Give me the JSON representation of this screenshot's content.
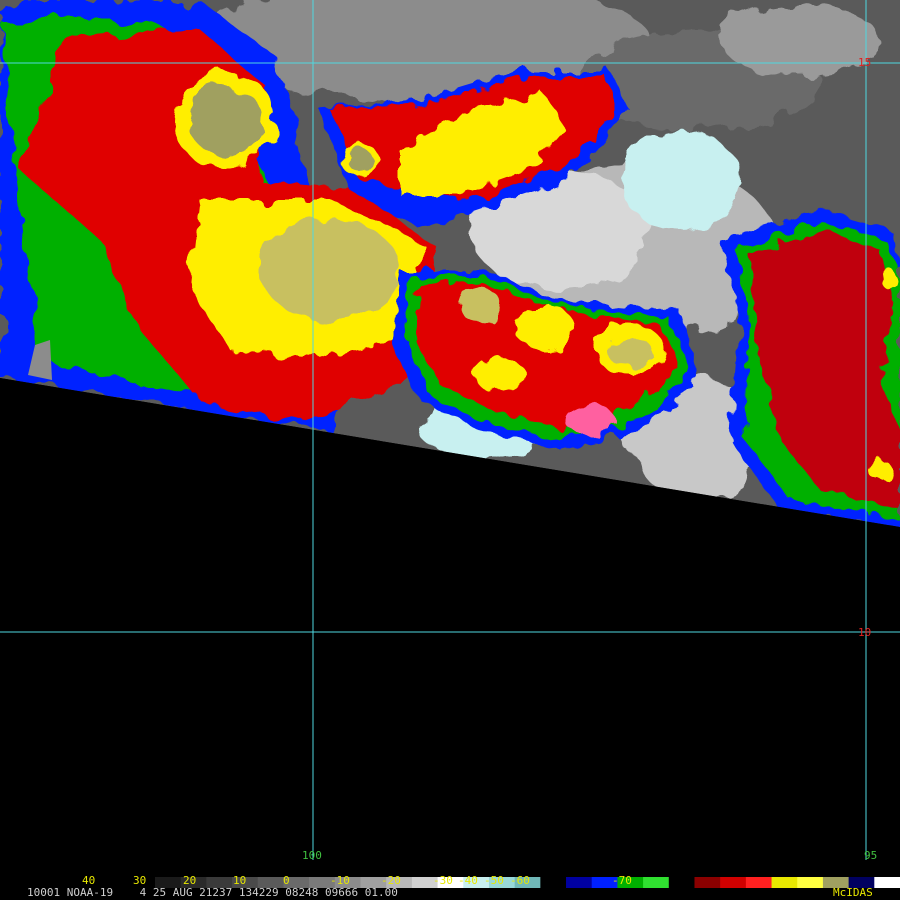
{
  "colors": {
    "grid": "#4fd8e0",
    "lat_label": "#e02020",
    "lon_label": "#40c040",
    "tick_label": "#e8e800",
    "info_text": "#d0d0d0",
    "brand": "#e8e800",
    "no_data": "#000000"
  },
  "map": {
    "lat_labels": [
      "15",
      "10"
    ],
    "lon_labels": [
      "100",
      "95"
    ]
  },
  "colorbar": {
    "tick_labels": [
      "40",
      "30",
      "20",
      "10",
      "0",
      "-10",
      "-20",
      "-30",
      "-40",
      "-50",
      "-60"
    ],
    "extra_label": "-70",
    "segments": [
      "#1a1a1a",
      "#2a2a2a",
      "#3a3a3a",
      "#4a4a4a",
      "#5a5a5a",
      "#6a6a6a",
      "#7a7a7a",
      "#8c8c8c",
      "#a0a0a0",
      "#b8b8b8",
      "#d0d0d0",
      "#ffffff",
      "#c8f0f0",
      "#98d8d8",
      "#70b8b8",
      "#000000",
      "#0000a0",
      "#0020ff",
      "#00b000",
      "#30e030",
      "#000000",
      "#8b0000",
      "#d00000",
      "#ff2020",
      "#e8e800",
      "#ffff40",
      "#a0a060",
      "#000060",
      "#ffffff"
    ]
  },
  "footer": {
    "info": "10001 NOAA-19    4 25 AUG 21237 134229 08248 09666 01.00",
    "brand": "McIDAS"
  }
}
